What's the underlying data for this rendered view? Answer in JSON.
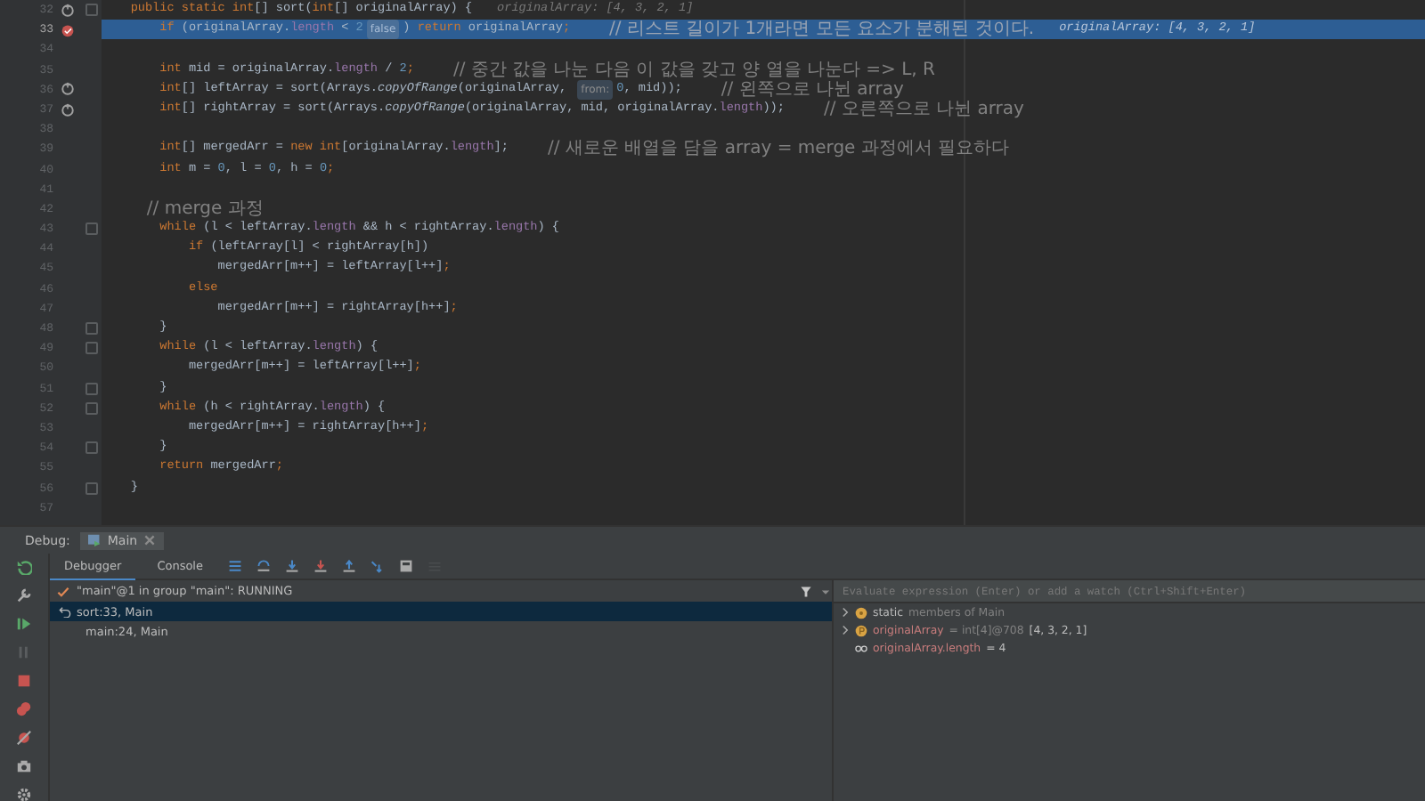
{
  "editor": {
    "lines": [
      {
        "number": "32",
        "kind": "recursion",
        "fold": true,
        "current": false,
        "tokens": [
          {
            "kind": "keyword",
            "text": "    public static int"
          },
          {
            "kind": "plain",
            "text": "[] sort("
          },
          {
            "kind": "keyword",
            "text": "int"
          },
          {
            "kind": "plain",
            "text": "[] originalArray) {"
          },
          {
            "kind": "value",
            "text": "originalArray: [4, 3, 2, 1]"
          }
        ]
      },
      {
        "number": "33",
        "kind": "breakpoint",
        "fold": false,
        "current": true,
        "tokens": [
          {
            "kind": "keyword",
            "text": "        if"
          },
          {
            "kind": "plain",
            "text": " (originalArray."
          },
          {
            "kind": "field",
            "text": "length"
          },
          {
            "kind": "plain",
            "text": " < "
          },
          {
            "kind": "number",
            "text": "2"
          },
          {
            "kind": "hint",
            "text": "false"
          },
          {
            "kind": "plain",
            "text": ") "
          },
          {
            "kind": "keyword",
            "text": "return"
          },
          {
            "kind": "plain",
            "text": " originalArray"
          },
          {
            "kind": "keyword",
            "text": ";"
          },
          {
            "kind": "comment",
            "text": "// 리스트 길이가 1개라면 모든 요소가 분해된 것이다."
          },
          {
            "kind": "value",
            "text": "originalArray: [4, 3, 2, 1]"
          }
        ]
      },
      {
        "number": "34",
        "kind": "plain",
        "fold": false,
        "current": false
      },
      {
        "number": "35",
        "kind": "plain",
        "fold": false,
        "current": false,
        "tokens": [
          {
            "kind": "keyword",
            "text": "        int"
          },
          {
            "kind": "plain",
            "text": " mid = originalArray."
          },
          {
            "kind": "field",
            "text": "length"
          },
          {
            "kind": "plain",
            "text": " / "
          },
          {
            "kind": "number",
            "text": "2"
          },
          {
            "kind": "keyword",
            "text": ";"
          },
          {
            "kind": "comment",
            "text": "// 중간 값을 나눈 다음 이 값을 갖고 양 열을 나눈다 => L, R"
          }
        ]
      },
      {
        "number": "36",
        "kind": "recursion",
        "fold": false,
        "current": false,
        "tokens": [
          {
            "kind": "keyword",
            "text": "        int"
          },
          {
            "kind": "plain",
            "text": "[] leftArray = sort(Arrays."
          },
          {
            "kind": "method",
            "text": "copyOfRange"
          },
          {
            "kind": "plain",
            "text": "(originalArray, "
          },
          {
            "kind": "hint",
            "text": "from:"
          },
          {
            "kind": "number",
            "text": "0"
          },
          {
            "kind": "plain",
            "text": ", mid));"
          },
          {
            "kind": "comment",
            "text": "// 왼쪽으로 나뉜 array"
          }
        ]
      },
      {
        "number": "37",
        "kind": "recursion",
        "fold": false,
        "current": false,
        "tokens": [
          {
            "kind": "keyword",
            "text": "        int"
          },
          {
            "kind": "plain",
            "text": "[] rightArray = sort(Arrays."
          },
          {
            "kind": "method",
            "text": "copyOfRange"
          },
          {
            "kind": "plain",
            "text": "(originalArray, mid, originalArray."
          },
          {
            "kind": "field",
            "text": "length"
          },
          {
            "kind": "plain",
            "text": "));"
          },
          {
            "kind": "comment",
            "text": "// 오른쪽으로 나뉜 array"
          }
        ]
      },
      {
        "number": "38",
        "kind": "plain",
        "fold": false,
        "current": false
      },
      {
        "number": "39",
        "kind": "plain",
        "fold": false,
        "current": false,
        "tokens": [
          {
            "kind": "keyword",
            "text": "        int"
          },
          {
            "kind": "plain",
            "text": "[] mergedArr = "
          },
          {
            "kind": "keyword",
            "text": "new int"
          },
          {
            "kind": "plain",
            "text": "[originalArray."
          },
          {
            "kind": "field",
            "text": "length"
          },
          {
            "kind": "plain",
            "text": "];"
          },
          {
            "kind": "comment",
            "text": "// 새로운 배열을 담을 array = merge 과정에서 필요하다"
          }
        ]
      },
      {
        "number": "40",
        "kind": "plain",
        "fold": false,
        "current": false,
        "tokens": [
          {
            "kind": "keyword",
            "text": "        int"
          },
          {
            "kind": "plain",
            "text": " m = "
          },
          {
            "kind": "number",
            "text": "0"
          },
          {
            "kind": "plain",
            "text": ", l = "
          },
          {
            "kind": "number",
            "text": "0"
          },
          {
            "kind": "plain",
            "text": ", h = "
          },
          {
            "kind": "number",
            "text": "0"
          },
          {
            "kind": "keyword",
            "text": ";"
          }
        ]
      },
      {
        "number": "41",
        "kind": "plain",
        "fold": false,
        "current": false
      },
      {
        "number": "42",
        "kind": "plain",
        "fold": false,
        "current": false,
        "tokens": [
          {
            "kind": "comment",
            "text": "        // merge 과정"
          }
        ]
      },
      {
        "number": "43",
        "kind": "plain",
        "fold": true,
        "current": false,
        "tokens": [
          {
            "kind": "keyword",
            "text": "        while"
          },
          {
            "kind": "plain",
            "text": " (l < leftArray."
          },
          {
            "kind": "field",
            "text": "length"
          },
          {
            "kind": "plain",
            "text": " && h < rightArray."
          },
          {
            "kind": "field",
            "text": "length"
          },
          {
            "kind": "plain",
            "text": ") {"
          }
        ]
      },
      {
        "number": "44",
        "kind": "plain",
        "fold": false,
        "current": false,
        "tokens": [
          {
            "kind": "keyword",
            "text": "            if"
          },
          {
            "kind": "plain",
            "text": " (leftArray[l] < rightArray[h])"
          }
        ]
      },
      {
        "number": "45",
        "kind": "plain",
        "fold": false,
        "current": false,
        "tokens": [
          {
            "kind": "plain",
            "text": "                mergedArr[m++] = leftArray[l++]"
          },
          {
            "kind": "keyword",
            "text": ";"
          }
        ]
      },
      {
        "number": "46",
        "kind": "plain",
        "fold": false,
        "current": false,
        "tokens": [
          {
            "kind": "keyword",
            "text": "            else"
          }
        ]
      },
      {
        "number": "47",
        "kind": "plain",
        "fold": false,
        "current": false,
        "tokens": [
          {
            "kind": "plain",
            "text": "                mergedArr[m++] = rightArray[h++]"
          },
          {
            "kind": "keyword",
            "text": ";"
          }
        ]
      },
      {
        "number": "48",
        "kind": "plain",
        "fold": true,
        "current": false,
        "tokens": [
          {
            "kind": "plain",
            "text": "        }"
          }
        ]
      },
      {
        "number": "49",
        "kind": "plain",
        "fold": true,
        "current": false,
        "tokens": [
          {
            "kind": "keyword",
            "text": "        while"
          },
          {
            "kind": "plain",
            "text": " (l < leftArray."
          },
          {
            "kind": "field",
            "text": "length"
          },
          {
            "kind": "plain",
            "text": ") {"
          }
        ]
      },
      {
        "number": "50",
        "kind": "plain",
        "fold": false,
        "current": false,
        "tokens": [
          {
            "kind": "plain",
            "text": "            mergedArr[m++] = leftArray[l++]"
          },
          {
            "kind": "keyword",
            "text": ";"
          }
        ]
      },
      {
        "number": "51",
        "kind": "plain",
        "fold": true,
        "current": false,
        "tokens": [
          {
            "kind": "plain",
            "text": "        }"
          }
        ]
      },
      {
        "number": "52",
        "kind": "plain",
        "fold": true,
        "current": false,
        "tokens": [
          {
            "kind": "keyword",
            "text": "        while"
          },
          {
            "kind": "plain",
            "text": " (h < rightArray."
          },
          {
            "kind": "field",
            "text": "length"
          },
          {
            "kind": "plain",
            "text": ") {"
          }
        ]
      },
      {
        "number": "53",
        "kind": "plain",
        "fold": false,
        "current": false,
        "tokens": [
          {
            "kind": "plain",
            "text": "            mergedArr[m++] = rightArray[h++]"
          },
          {
            "kind": "keyword",
            "text": ";"
          }
        ]
      },
      {
        "number": "54",
        "kind": "plain",
        "fold": true,
        "current": false,
        "tokens": [
          {
            "kind": "plain",
            "text": "        }"
          }
        ]
      },
      {
        "number": "55",
        "kind": "plain",
        "fold": false,
        "current": false,
        "tokens": [
          {
            "kind": "keyword",
            "text": "        return"
          },
          {
            "kind": "plain",
            "text": " mergedArr"
          },
          {
            "kind": "keyword",
            "text": ";"
          }
        ]
      },
      {
        "number": "56",
        "kind": "plain",
        "fold": true,
        "current": false,
        "tokens": [
          {
            "kind": "plain",
            "text": "    }"
          }
        ]
      },
      {
        "number": "57",
        "kind": "plain",
        "fold": false,
        "current": false
      }
    ]
  },
  "debug": {
    "label": "Debug:",
    "session_tab": "Main",
    "tabs": [
      {
        "label": "Debugger",
        "selected": true
      },
      {
        "label": "Console",
        "selected": false
      }
    ],
    "toolbar": [
      {
        "kind": "frames",
        "disabled": false
      },
      {
        "kind": "step-over",
        "disabled": false
      },
      {
        "kind": "step-into",
        "disabled": false
      },
      {
        "kind": "force-step-into",
        "disabled": false
      },
      {
        "kind": "step-out",
        "disabled": false
      },
      {
        "kind": "run-to-cursor",
        "disabled": false
      },
      {
        "kind": "evaluate",
        "disabled": false
      },
      {
        "kind": "trace",
        "disabled": true
      }
    ],
    "side_tools": [
      {
        "kind": "rerun"
      },
      {
        "kind": "wrench"
      },
      {
        "kind": "resume"
      },
      {
        "kind": "pause"
      },
      {
        "kind": "stop"
      },
      {
        "kind": "breakpoints"
      },
      {
        "kind": "mute"
      },
      {
        "kind": "camera"
      },
      {
        "kind": "settings"
      }
    ],
    "thread": "\"main\"@1 in group \"main\": RUNNING",
    "frames": [
      {
        "label": "sort:33, Main",
        "selected": true
      },
      {
        "label": "main:24, Main",
        "selected": false
      }
    ],
    "evaluate": {
      "placeholder": "Evaluate expression (Enter) or add a watch (Ctrl+Shift+Enter)"
    },
    "variables": [
      {
        "kind": "static",
        "expandable": true,
        "name": "static",
        "value": "members of Main"
      },
      {
        "kind": "parameter",
        "expandable": true,
        "name": "originalArray",
        "type": "= int[4]@708",
        "value": "[4, 3, 2, 1]"
      },
      {
        "kind": "watch",
        "expandable": false,
        "name": "originalArray.length",
        "value": "= 4"
      }
    ]
  }
}
